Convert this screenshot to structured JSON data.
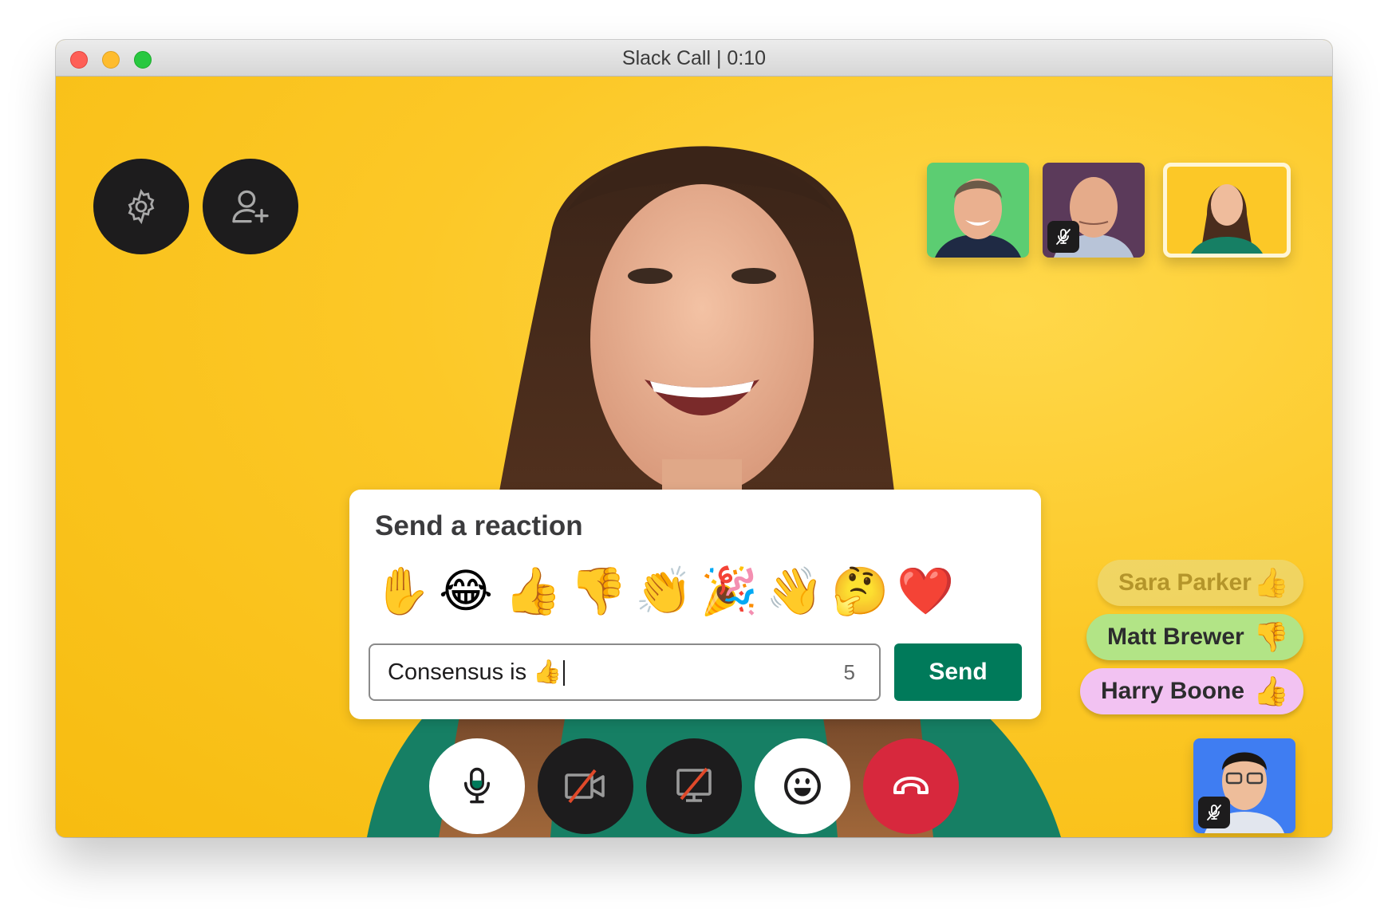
{
  "window": {
    "title": "Slack Call | 0:10",
    "traffic_lights": [
      "close",
      "minimize",
      "maximize"
    ]
  },
  "top_controls": {
    "settings": {
      "icon": "gear-icon"
    },
    "add_people": {
      "icon": "add-person-icon"
    }
  },
  "participants_thumbnails": [
    {
      "background": "#5ccd72",
      "muted": false,
      "active": false
    },
    {
      "background": "#5b3a5a",
      "muted": true,
      "active": false
    },
    {
      "background": "#fcc827",
      "muted": false,
      "active": true
    }
  ],
  "self_view": {
    "background": "#3f7df2",
    "muted": true
  },
  "reaction_card": {
    "title": "Send a reaction",
    "emojis": [
      {
        "name": "raised-hand",
        "glyph": "✋"
      },
      {
        "name": "joy",
        "glyph": "😂"
      },
      {
        "name": "thumbs-up",
        "glyph": "👍"
      },
      {
        "name": "thumbs-down",
        "glyph": "👎"
      },
      {
        "name": "clap",
        "glyph": "👏"
      },
      {
        "name": "tada",
        "glyph": "🎉"
      },
      {
        "name": "wave",
        "glyph": "👋"
      },
      {
        "name": "thinking",
        "glyph": "🤔"
      },
      {
        "name": "heart",
        "glyph": "❤️"
      }
    ],
    "input_value": "Consensus is 👍",
    "char_count": "5",
    "send_label": "Send"
  },
  "reactions_feed": [
    {
      "name": "Sara Parker",
      "emoji": "👍",
      "color": "#e8de8f",
      "faded": true
    },
    {
      "name": "Matt Brewer",
      "emoji": "👎",
      "color": "#b2e486",
      "faded": false
    },
    {
      "name": "Harry Boone",
      "emoji": "👍",
      "color": "#f2c2f2",
      "faded": false
    }
  ],
  "call_controls": [
    {
      "name": "microphone",
      "state": "on"
    },
    {
      "name": "video",
      "state": "off"
    },
    {
      "name": "screen-share",
      "state": "off"
    },
    {
      "name": "reactions",
      "state": "open"
    },
    {
      "name": "leave-call",
      "state": "danger"
    }
  ],
  "colors": {
    "accent_green": "#007a5a",
    "leave_red": "#d7283d",
    "control_dark": "#1d1c1d",
    "stage_yellow": "#fcc827"
  }
}
